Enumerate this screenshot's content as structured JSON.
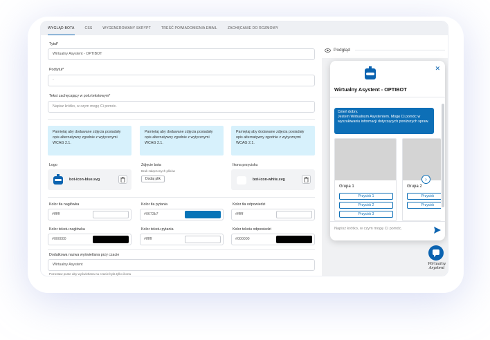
{
  "tabs": [
    "WYGLĄD BOTA",
    "CSS",
    "WYGENEROWANY SKRYPT",
    "TREŚĆ POWIADOMIENIA EMAIL",
    "ZACHĘCANIE DO ROZMOWY"
  ],
  "form": {
    "title_label": "Tytuł*",
    "title_value": "Wirtualny Asystent - OPTIBOT",
    "subtitle_label": "Podtytuł*",
    "subtitle_value": "-",
    "prompt_label": "Tekst zachęcający w polu tekstowym*",
    "prompt_value": "Napisz krótko, w czym mogę Ci pomóc.",
    "info_text": "Pamiętaj aby dodawane zdjęcia posiadały opis alternatywny zgodnie z wytycznymi WCAG 2.1.",
    "logo_label": "Logo",
    "logo_file": "bot-icon-blue.svg",
    "bot_image_label": "Zdjęcie bota",
    "bot_image_empty": "Brak załączonych plików",
    "add_file_label": "Dodaj plik",
    "button_icon_label": "Ikona przycisku",
    "button_icon_file": "bot-icon-white.svg",
    "header_bg_label": "Kolor tła nagłówka",
    "header_bg_value": "#ffffff",
    "question_bg_label": "Kolor tła pytania",
    "question_bg_value": "#0673b7",
    "answer_bg_label": "Kolor tła odpowiedzi",
    "answer_bg_value": "#ffffff",
    "header_text_label": "Kolor tekstu nagłówka",
    "header_text_value": "#000000",
    "question_text_label": "Kolor tekstu pytania",
    "question_text_value": "#ffffff",
    "answer_text_label": "Kolor tekstu odpowiedzi",
    "answer_text_value": "#000000",
    "extra_name_label": "Dodatkowa nazwa wyświetlana przy czacie",
    "extra_name_value": "Wirtualny Asystent",
    "extra_name_hint": "Pozostaw puste aby wyświetlana na czacie była tylko ikona"
  },
  "colors": {
    "accent": "#0b63b0",
    "question_bg": "#0673b7",
    "info_bg": "#d7f1fc",
    "white": "#ffffff",
    "black": "#000000"
  },
  "preview": {
    "label": "Podgląd",
    "title": "Wirtualny Asystent - OPTIBOT",
    "greeting": "Dzień dobry.\nJestem Wirtualnym Asystentem. Mogę Ci pomóc w wyszukiwaniu informacji dotyczących poniższych spraw.",
    "groups": [
      {
        "title": "Grupa 1",
        "buttons": [
          "Przycisk 1",
          "Przycisk 2",
          "Przycisk 3"
        ]
      },
      {
        "title": "Grupa 2",
        "buttons": [
          "Przycisk",
          "Przycisk"
        ]
      }
    ],
    "input_placeholder": "Napisz krótko, w czym mogę Ci pomóc.",
    "fab_label_line1": "Wirtualny",
    "fab_label_line2": "Asystent"
  }
}
